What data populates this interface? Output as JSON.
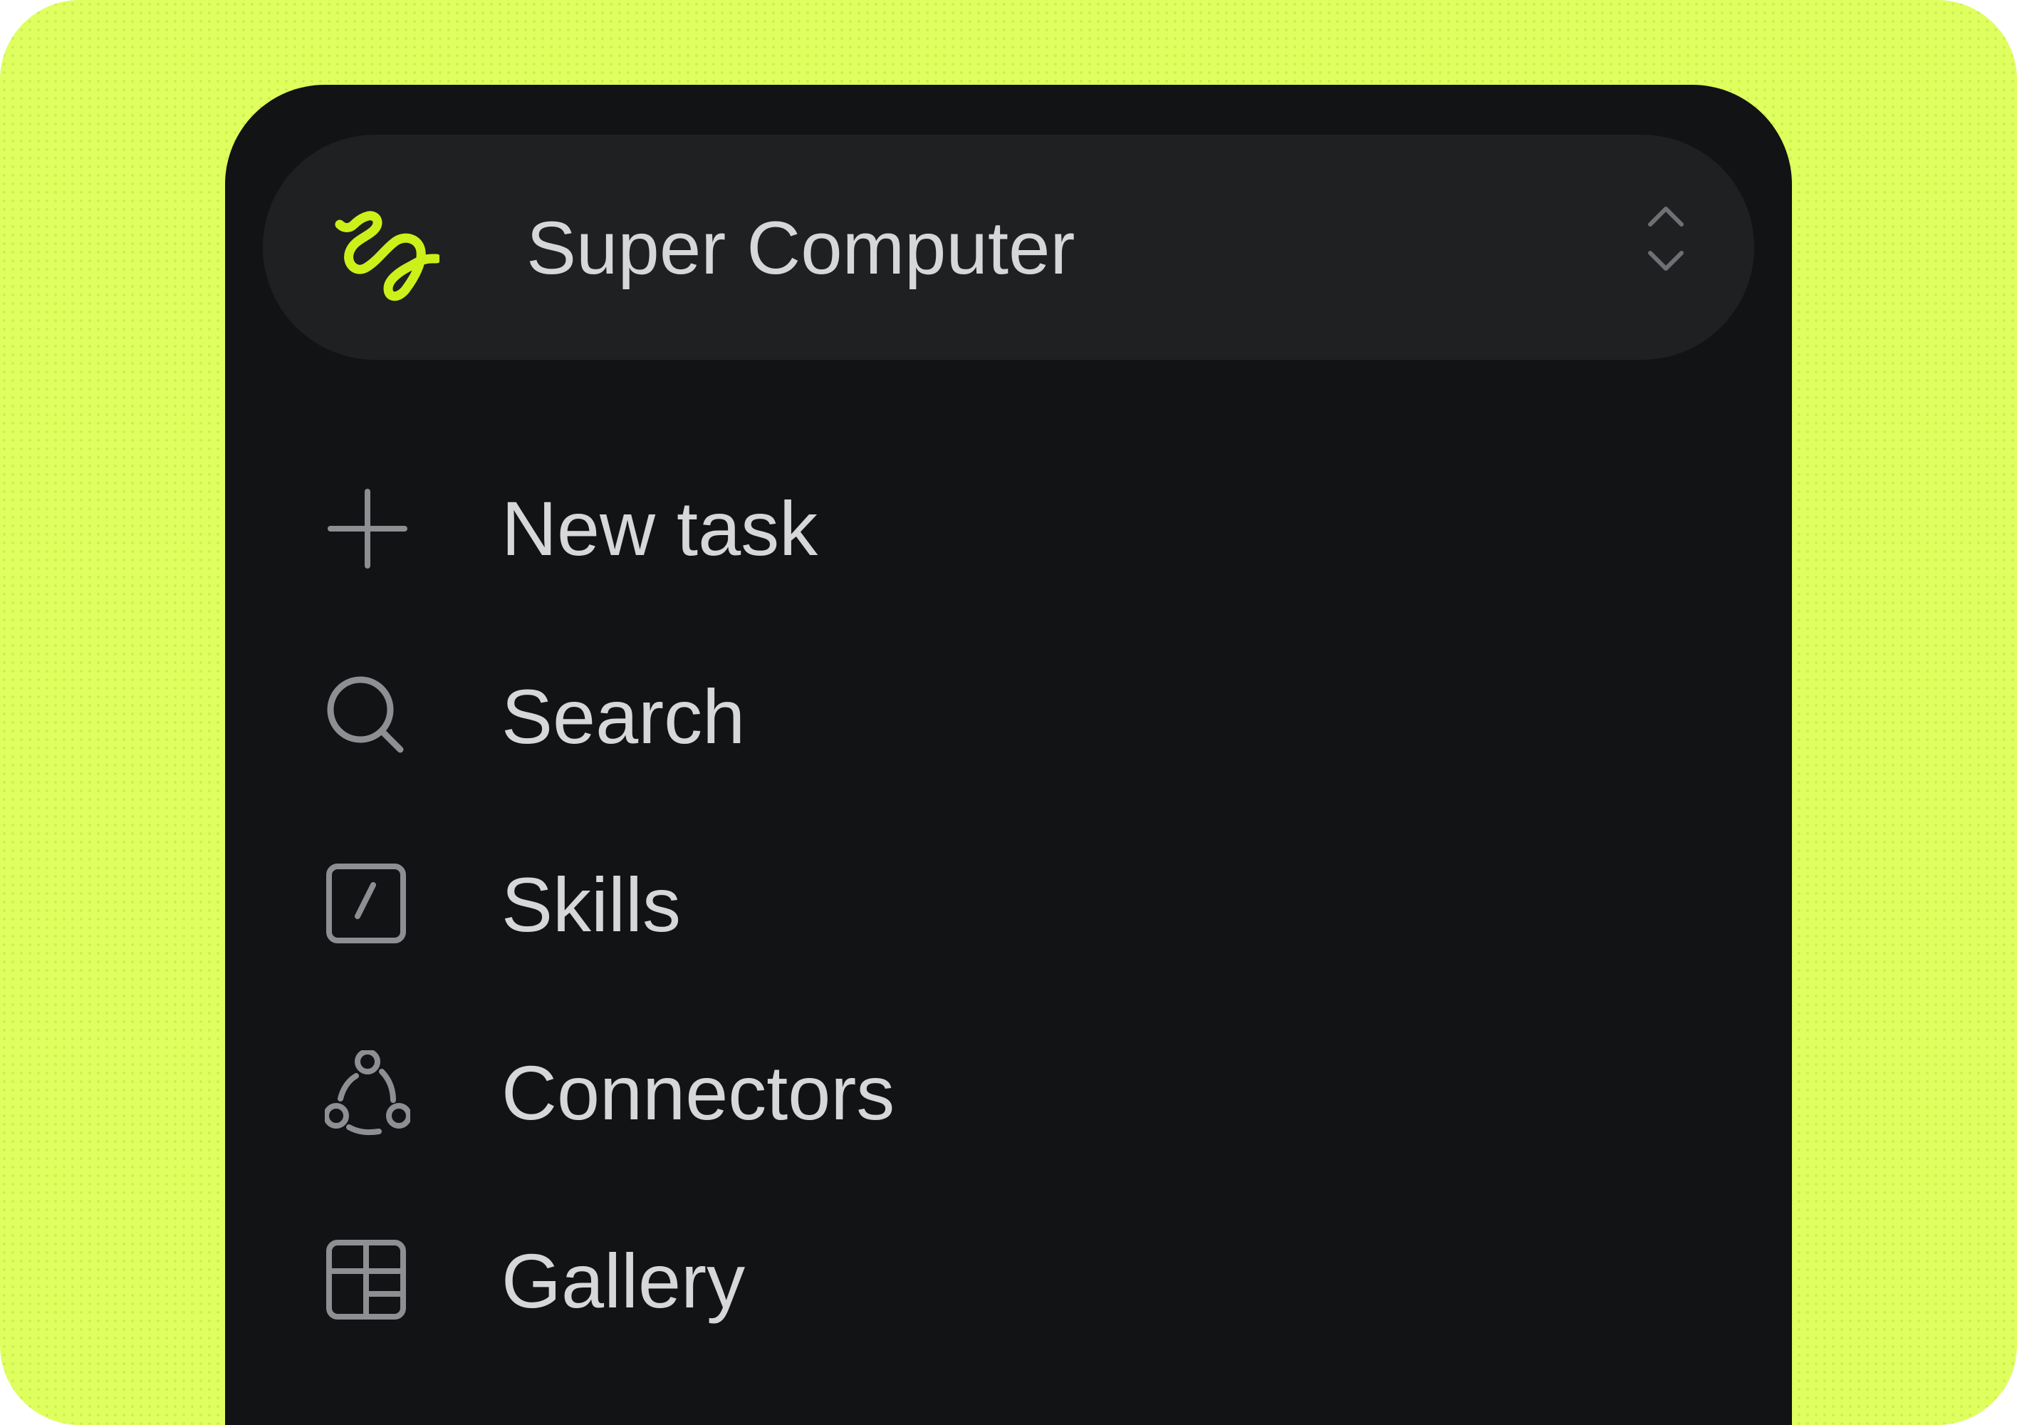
{
  "workspace": {
    "name": "Super Computer",
    "logo_icon": "squiggle-logo-icon",
    "switcher_icon": "chevron-up-down-icon"
  },
  "nav": {
    "items": [
      {
        "label": "New task",
        "icon": "plus-icon"
      },
      {
        "label": "Search",
        "icon": "search-icon"
      },
      {
        "label": "Skills",
        "icon": "slash-box-icon"
      },
      {
        "label": "Connectors",
        "icon": "connectors-icon"
      },
      {
        "label": "Gallery",
        "icon": "gallery-grid-icon"
      }
    ]
  },
  "colors": {
    "background": "#DFFF5F",
    "panel": "#121315",
    "workspace_pill": "#1F2022",
    "text": "#D7D7DA",
    "icon": "#8E8F93",
    "accent": "#CCF01A"
  }
}
